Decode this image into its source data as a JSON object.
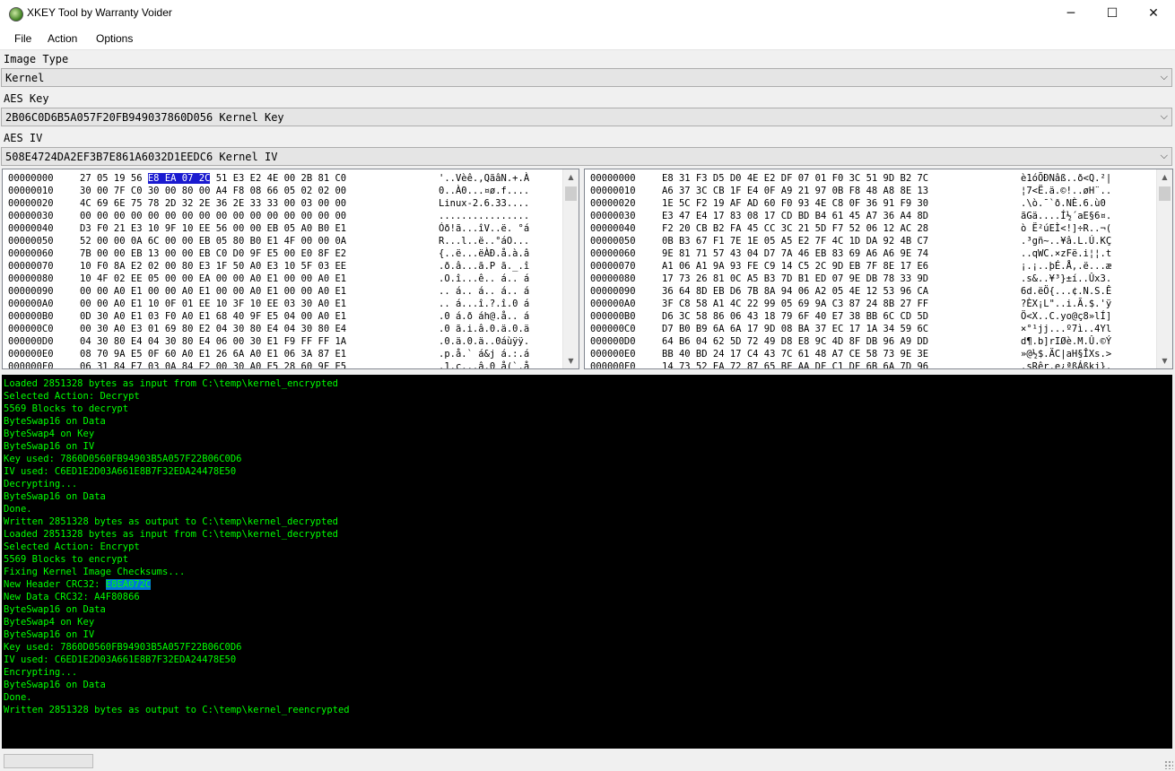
{
  "window": {
    "title": "XKEY Tool by Warranty Voider",
    "icon": "xbox-logo-icon",
    "minimize_icon": "─",
    "maximize_icon": "☐",
    "close_icon": "✕"
  },
  "menu": {
    "file": "File",
    "action": "Action",
    "options": "Options"
  },
  "image_type": {
    "label": "Image Type",
    "value": "Kernel"
  },
  "aes_key": {
    "label": "AES Key",
    "value": "2B06C0D6B5A057F20FB949037860D056 Kernel Key"
  },
  "aes_iv": {
    "label": "AES IV",
    "value": "508E4724DA2EF3B7E861A6032D1EEDC6 Kernel IV"
  },
  "combo_arrow_icon": "⌵",
  "hex_left": {
    "selection": {
      "row": 0,
      "text": "E8 EA 07 2C"
    },
    "rows": [
      {
        "off": "00000000",
        "pre": "27 05 19 56 ",
        "sel": "E8 EA 07 2C",
        "post": " 51 E3 E2 4E 00 2B 81 C0",
        "ascii": "'..Vèê.,QãâN.+.À"
      },
      {
        "off": "00000010",
        "pre": "30 00 7F C0 30 00 80 00 A4 F8 08 66 05 02 02 00",
        "sel": "",
        "post": "",
        "ascii": "0..À0...¤ø.f...."
      },
      {
        "off": "00000020",
        "pre": "4C 69 6E 75 78 2D 32 2E 36 2E 33 33 00 03 00 00",
        "sel": "",
        "post": "",
        "ascii": "Linux-2.6.33...."
      },
      {
        "off": "00000030",
        "pre": "00 00 00 00 00 00 00 00 00 00 00 00 00 00 00 00",
        "sel": "",
        "post": "",
        "ascii": "................"
      },
      {
        "off": "00000040",
        "pre": "D3 F0 21 E3 10 9F 10 EE 56 00 00 EB 05 A0 B0 E1",
        "sel": "",
        "post": "",
        "ascii": "Óð!ã...îV..ë. °á"
      },
      {
        "off": "00000050",
        "pre": "52 00 00 0A 6C 00 00 EB 05 80 B0 E1 4F 00 00 0A",
        "sel": "",
        "post": "",
        "ascii": "R...l..ë..°áO..."
      },
      {
        "off": "00000060",
        "pre": "7B 00 00 EB 13 00 00 EB C0 D0 9F E5 00 E0 8F E2",
        "sel": "",
        "post": "",
        "ascii": "{..ë...ëÀÐ.å.à.â"
      },
      {
        "off": "00000070",
        "pre": "10 F0 8A E2 02 00 80 E3 1F 50 A0 E3 10 5F 03 EE",
        "sel": "",
        "post": "",
        "ascii": ".ð.â...ã.P ã._.î"
      },
      {
        "off": "00000080",
        "pre": "10 4F 02 EE 05 00 00 EA 00 00 A0 E1 00 00 A0 E1",
        "sel": "",
        "post": "",
        "ascii": ".O.î...ê.. á.. á"
      },
      {
        "off": "00000090",
        "pre": "00 00 A0 E1 00 00 A0 E1 00 00 A0 E1 00 00 A0 E1",
        "sel": "",
        "post": "",
        "ascii": ".. á.. á.. á.. á"
      },
      {
        "off": "000000A0",
        "pre": "00 00 A0 E1 10 0F 01 EE 10 3F 10 EE 03 30 A0 E1",
        "sel": "",
        "post": "",
        "ascii": ".. á...î.?.î.0 á"
      },
      {
        "off": "000000B0",
        "pre": "0D 30 A0 E1 03 F0 A0 E1 68 40 9F E5 04 00 A0 E1",
        "sel": "",
        "post": "",
        "ascii": ".0 á.ð áh@.å.. á"
      },
      {
        "off": "000000C0",
        "pre": "00 30 A0 E3 01 69 80 E2 04 30 80 E4 04 30 80 E4",
        "sel": "",
        "post": "",
        "ascii": ".0 ã.i.â.0.ä.0.ä"
      },
      {
        "off": "000000D0",
        "pre": "04 30 80 E4 04 30 80 E4 06 00 30 E1 F9 FF FF 1A",
        "sel": "",
        "post": "",
        "ascii": ".0.ä.0.ä..0áùÿÿ."
      },
      {
        "off": "000000E0",
        "pre": "08 70 9A E5 0F 60 A0 E1 26 6A A0 E1 06 3A 87 E1",
        "sel": "",
        "post": "",
        "ascii": ".p.å.` á&j á.:.á"
      },
      {
        "off": "000000F0",
        "pre": "06 31 84 E7 03 0A 84 E2 00 30 A0 E5 28 60 9F E5",
        "sel": "",
        "post": "",
        "ascii": ".1.ç...â.0 å(`.å"
      }
    ]
  },
  "hex_right": {
    "rows": [
      {
        "off": "00000000",
        "bytes": "E8 31 F3 D5 D0 4E E2 DF 07 01 F0 3C 51 9D B2 7C",
        "ascii": "è1óÕÐNâß..ð<Q.²|"
      },
      {
        "off": "00000010",
        "bytes": "A6 37 3C CB 1F E4 0F A9 21 97 0B F8 48 A8 8E 13",
        "ascii": "¦7<Ë.ä.©!..øH¨.."
      },
      {
        "off": "00000020",
        "bytes": "1E 5C F2 19 AF AD 60 F0 93 4E C8 0F 36 91 F9 30",
        "ascii": ".\\ò.¯­`ð.NÈ.6.ù0"
      },
      {
        "off": "00000030",
        "bytes": "E3 47 E4 17 83 08 17 CD BD B4 61 45 A7 36 A4 8D",
        "ascii": "ãGä....Í½´aE§6¤."
      },
      {
        "off": "00000040",
        "bytes": "F2 20 CB B2 FA 45 CC 3C 21 5D F7 52 06 12 AC 28",
        "ascii": "ò Ë²úEÌ<!]÷R..¬("
      },
      {
        "off": "00000050",
        "bytes": "0B B3 67 F1 7E 1E 05 A5 E2 7F 4C 1D DA 92 4B C7",
        "ascii": ".³gñ~..¥â.L.Ú.KÇ"
      },
      {
        "off": "00000060",
        "bytes": "9E 81 71 57 43 04 D7 7A 46 EB 83 69 A6 A6 9E 74",
        "ascii": "..qWC.×zFë.i¦¦.t"
      },
      {
        "off": "00000070",
        "bytes": "A1 06 A1 9A 93 FE C9 14 C5 2C 9D EB 7F 8E 17 E6",
        "ascii": "¡.¡..þÉ.Å,.ë...æ"
      },
      {
        "off": "00000080",
        "bytes": "17 73 26 81 0C A5 B3 7D B1 ED 07 9E DB 78 33 9D",
        "ascii": ".s&..¥³}±í..Ûx3."
      },
      {
        "off": "00000090",
        "bytes": "36 64 8D EB D6 7B 8A 94 06 A2 05 4E 12 53 96 CA",
        "ascii": "6d.ëÖ{...¢.N.S.Ê"
      },
      {
        "off": "000000A0",
        "bytes": "3F C8 58 A1 4C 22 99 05 69 9A C3 87 24 8B 27 FF",
        "ascii": "?ÈX¡L\"..i.Ã.$.'ÿ"
      },
      {
        "off": "000000B0",
        "bytes": "D6 3C 58 86 06 43 18 79 6F 40 E7 38 BB 6C CD 5D",
        "ascii": "Ö<X..C.yo@ç8»lÍ]"
      },
      {
        "off": "000000C0",
        "bytes": "D7 B0 B9 6A 6A 17 9D 08 BA 37 EC 17 1A 34 59 6C",
        "ascii": "×°¹jj...º7ì..4Yl"
      },
      {
        "off": "000000D0",
        "bytes": "64 B6 04 62 5D 72 49 D8 E8 9C 4D 8F DB 96 A9 DD",
        "ascii": "d¶.b]rIØè.M.Û.©Ý"
      },
      {
        "off": "000000E0",
        "bytes": "BB 40 BD 24 17 C4 43 7C 61 48 A7 CE 58 73 9E 3E",
        "ascii": "»@½$.ÄC|aH§ÎXs.>"
      },
      {
        "off": "000000F0",
        "bytes": "14 73 52 EA 72 87 65 BF AA DF C1 DF 6B 6A 7D 96",
        "ascii": ".sRêr.e¿ªßÁßkj}."
      }
    ]
  },
  "log": {
    "highlight": {
      "line": 16,
      "text": "E8EA072C"
    },
    "lines": [
      "Loaded 2851328 bytes as input from C:\\temp\\kernel_encrypted",
      "Selected Action: Decrypt",
      "5569 Blocks to decrypt",
      "ByteSwap16 on Data",
      "ByteSwap4 on Key",
      "ByteSwap16 on IV",
      "Key used: 7860D0560FB94903B5A057F22B06C0D6",
      "IV used: C6ED1E2D03A661E8B7F32EDA24478E50",
      "Decrypting...",
      "ByteSwap16 on Data",
      "Done.",
      "Written 2851328 bytes as output to C:\\temp\\kernel_decrypted",
      "Loaded 2851328 bytes as input from C:\\temp\\kernel_decrypted",
      "Selected Action: Encrypt",
      "5569 Blocks to encrypt",
      "Fixing Kernel Image Checksums...",
      "New Header CRC32: ",
      "New Data CRC32: A4F80866",
      "ByteSwap16 on Data",
      "ByteSwap4 on Key",
      "ByteSwap16 on IV",
      "Key used: 7860D0560FB94903B5A057F22B06C0D6",
      "IV used: C6ED1E2D03A661E8B7F32EDA24478E50",
      "Encrypting...",
      "ByteSwap16 on Data",
      "Done.",
      "Written 2851328 bytes as output to C:\\temp\\kernel_reencrypted"
    ]
  },
  "colors": {
    "console_bg": "#000000",
    "console_text": "#00ff00",
    "hex_selection": "#1a1ad0",
    "log_selection": "#0078d7"
  }
}
